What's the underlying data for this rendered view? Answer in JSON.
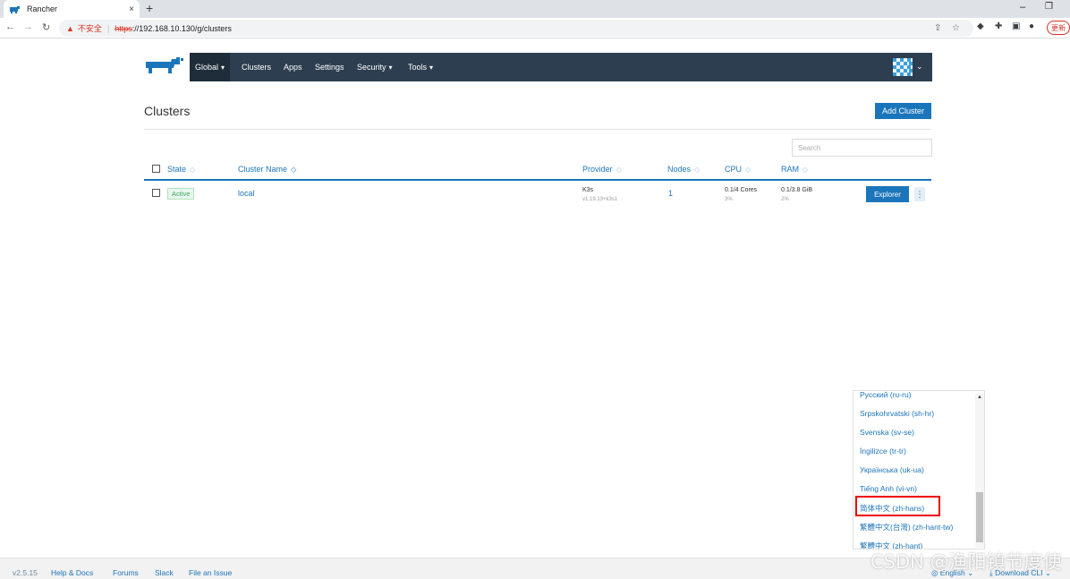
{
  "browser": {
    "tab_title": "Rancher",
    "tab_close": "×",
    "new_tab": "+",
    "window_minimize": "–",
    "window_restore": "❐",
    "insecure_label": "不安全",
    "url_scheme": "https",
    "url_rest": "://192.168.10.130/g/clusters",
    "update_label": "更新"
  },
  "nav": {
    "items": [
      {
        "label": "Global",
        "has_chevron": true,
        "active": true
      },
      {
        "label": "Clusters"
      },
      {
        "label": "Apps"
      },
      {
        "label": "Settings"
      },
      {
        "label": "Security",
        "has_chevron": true
      },
      {
        "label": "Tools",
        "has_chevron": true
      }
    ],
    "chevron": "⌄"
  },
  "page": {
    "title": "Clusters",
    "add_cluster": "Add Cluster",
    "search_placeholder": "Search"
  },
  "table": {
    "columns": [
      "State",
      "Cluster Name",
      "Provider",
      "Nodes",
      "CPU",
      "RAM"
    ],
    "sort_glyph": "◇",
    "rows": [
      {
        "state": "Active",
        "name": "local",
        "provider": "K3s",
        "provider_version": "v1.19.13+k3s1",
        "nodes": "1",
        "cpu": "0.1/4 Cores",
        "cpu_pct": "3%",
        "ram": "0.1/3.8 GiB",
        "ram_pct": "2%",
        "action": "Explorer",
        "kebab": "⋮"
      }
    ]
  },
  "language_menu": {
    "items": [
      "Русский (ru-ru)",
      "Srpskohrvatski (sh-hr)",
      "Svenska (sv-se)",
      "İngilizce (tr-tr)",
      "Українська (uk-ua)",
      "Tiếng Anh (vi-vn)",
      "简体中文 (zh-hans)",
      "繁體中文(台灣) (zh-hant-tw)",
      "繁體中文 (zh-hant)"
    ],
    "highlighted": "简体中文 (zh-hans)",
    "scroll_up": "▲"
  },
  "footer": {
    "version": "v2.5.15",
    "help": "Help & Docs",
    "forums": "Forums",
    "slack": "Slack",
    "file_issue": "File an Issue",
    "language": "English",
    "download_cli": "Download CLI"
  },
  "watermark": "CSDN @渔阳镇节度使",
  "colors": {
    "nav_bg": "#2d3e50",
    "accent": "#1b75bb",
    "active_green": "#3aa55a",
    "highlight_red": "#ee0000"
  }
}
